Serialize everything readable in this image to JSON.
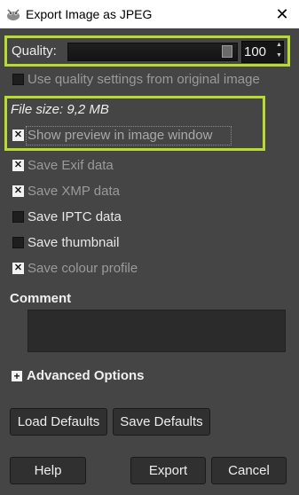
{
  "window": {
    "title": "Export Image as JPEG"
  },
  "quality": {
    "label": "Quality:",
    "value": "100",
    "level": 1.0
  },
  "options": {
    "use_quality": "Use quality settings from original image",
    "file_size": "File size: 9,2 MB",
    "show_preview": "Show preview in image window",
    "save_exif": "Save Exif data",
    "save_xmp": "Save XMP data",
    "save_iptc": "Save IPTC data",
    "save_thumbnail": "Save thumbnail",
    "save_colour_profile": "Save colour profile"
  },
  "comment": {
    "label": "Comment",
    "value": ""
  },
  "advanced": {
    "label": "Advanced Options"
  },
  "buttons": {
    "load_defaults": "Load Defaults",
    "save_defaults": "Save Defaults",
    "help": "Help",
    "export": "Export",
    "cancel": "Cancel"
  },
  "colors": {
    "highlight": "#b7dc2f",
    "background": "#454545"
  },
  "icons": {
    "app": "gimp-wilber-icon",
    "close": "close-icon",
    "checkmark": "check-x-icon"
  }
}
